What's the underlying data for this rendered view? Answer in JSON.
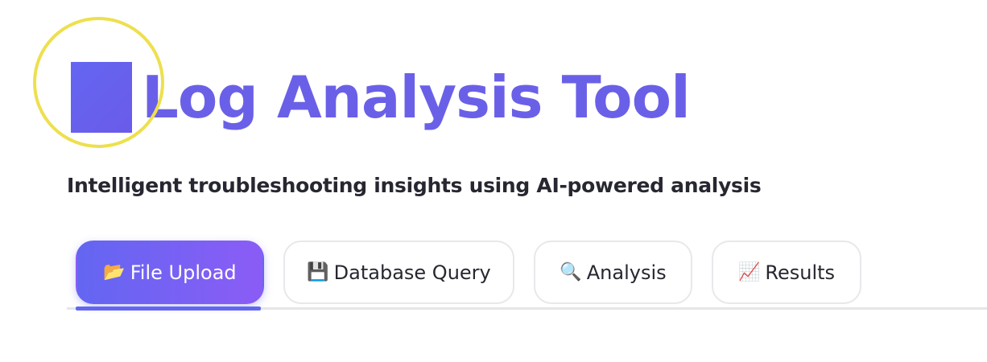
{
  "header": {
    "title": "Log Analysis Tool",
    "emblem_icon": "square-icon",
    "subtitle": "Intelligent troubleshooting insights using AI-powered analysis"
  },
  "tabs": [
    {
      "icon": "📂",
      "icon_name": "open-folder-icon",
      "label": "File Upload",
      "active": true
    },
    {
      "icon": "💾",
      "icon_name": "floppy-disk-icon",
      "label": "Database Query",
      "active": false
    },
    {
      "icon": "🔍",
      "icon_name": "magnifier-icon",
      "label": "Analysis",
      "active": false
    },
    {
      "icon": "📈",
      "icon_name": "chart-increasing-icon",
      "label": "Results",
      "active": false
    }
  ],
  "colors": {
    "accent": "#6366f1",
    "accent_gradient_end": "#8b5cf6",
    "highlight_ring": "#ede04e"
  }
}
